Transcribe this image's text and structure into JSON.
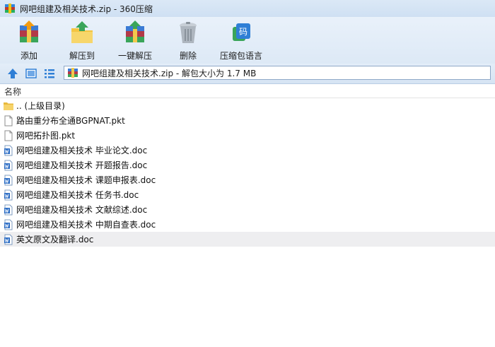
{
  "window": {
    "title": "网吧组建及相关技术.zip - 360压缩"
  },
  "toolbar": {
    "add_label": "添加",
    "extract_to_label": "解压到",
    "one_click_extract_label": "一键解压",
    "delete_label": "删除",
    "encoding_label": "压缩包语言",
    "encoding_icon_glyph": "码"
  },
  "address": {
    "path_text": "网吧组建及相关技术.zip - 解包大小为 1.7 MB"
  },
  "list": {
    "column_name": "名称",
    "items": [
      {
        "name": ".. (上级目录)",
        "type": "folder"
      },
      {
        "name": "路由重分布全通BGPNAT.pkt",
        "type": "pkt"
      },
      {
        "name": "网吧拓扑图.pkt",
        "type": "pkt"
      },
      {
        "name": "网吧组建及相关技术 毕业论文.doc",
        "type": "doc"
      },
      {
        "name": "网吧组建及相关技术 开题报告.doc",
        "type": "doc"
      },
      {
        "name": "网吧组建及相关技术 课题申报表.doc",
        "type": "doc"
      },
      {
        "name": "网吧组建及相关技术 任务书.doc",
        "type": "doc"
      },
      {
        "name": "网吧组建及相关技术 文献综述.doc",
        "type": "doc"
      },
      {
        "name": "网吧组建及相关技术 中期自查表.doc",
        "type": "doc"
      },
      {
        "name": "英文原文及翻译.doc",
        "type": "doc",
        "selected": true
      }
    ]
  },
  "colors": {
    "titlebar_bg": "#cfe0f3",
    "toolbar_bg": "#e2ecf8",
    "selected_row": "#eeeef0",
    "accent_blue": "#2f7fd6"
  }
}
